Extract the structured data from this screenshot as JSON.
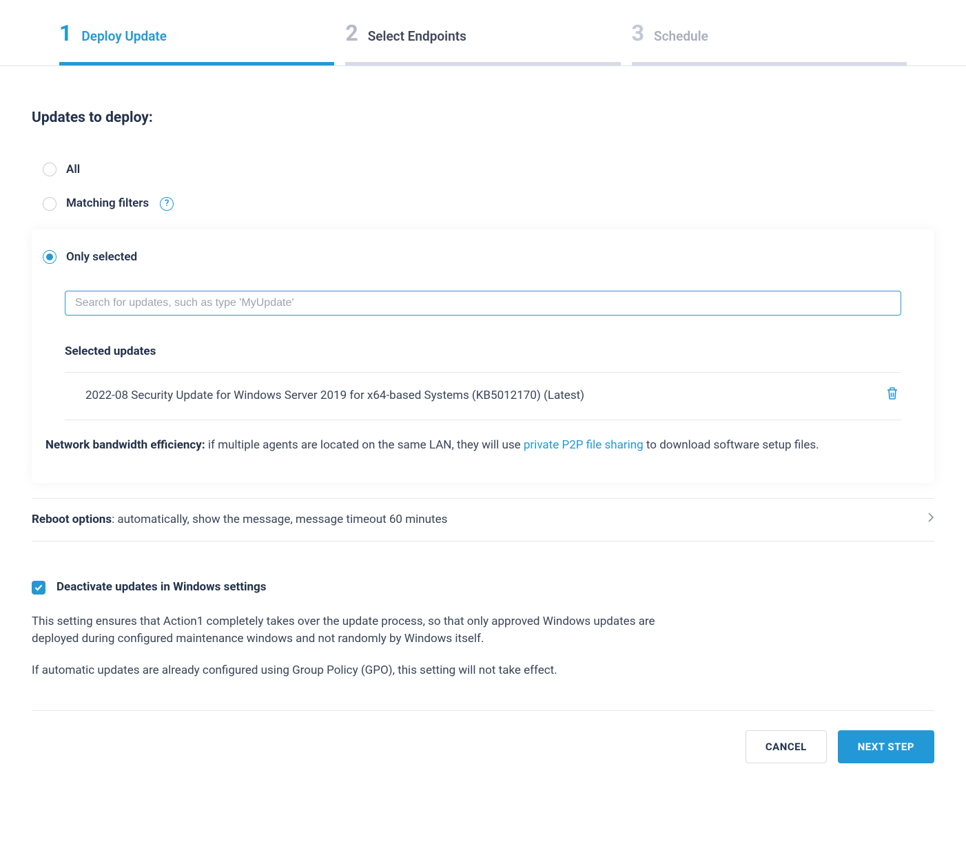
{
  "stepper": {
    "steps": [
      {
        "num": "1",
        "label": "Deploy Update",
        "state": "active"
      },
      {
        "num": "2",
        "label": "Select Endpoints",
        "state": "next"
      },
      {
        "num": "3",
        "label": "Schedule",
        "state": "future"
      }
    ]
  },
  "section_title": "Updates to deploy:",
  "updates_scope": {
    "all_label": "All",
    "matching_label": "Matching filters",
    "only_selected_label": "Only selected",
    "selected": "only_selected"
  },
  "search": {
    "placeholder": "Search for updates, such as type 'MyUpdate'",
    "value": ""
  },
  "selected_updates": {
    "heading": "Selected updates",
    "items": [
      {
        "name": "2022-08 Security Update for Windows Server 2019 for x64-based Systems (KB5012170) (Latest)"
      }
    ]
  },
  "network_info": {
    "bold": "Network bandwidth efficiency:",
    "text_before_link": " if multiple agents are located on the same LAN, they will use ",
    "link_text": "private P2P file sharing",
    "text_after_link": " to download software setup files."
  },
  "reboot": {
    "bold": "Reboot options",
    "summary": ": automatically, show the message, message timeout 60 minutes"
  },
  "deactivate": {
    "label": "Deactivate updates in Windows settings",
    "checked": true,
    "desc1": "This setting ensures that Action1 completely takes over the update process, so that only approved Windows updates are deployed during configured maintenance windows and not randomly by Windows itself.",
    "desc2": "If automatic updates are already configured using Group Policy (GPO), this setting will not take effect."
  },
  "footer": {
    "cancel": "CANCEL",
    "next": "NEXT STEP"
  }
}
